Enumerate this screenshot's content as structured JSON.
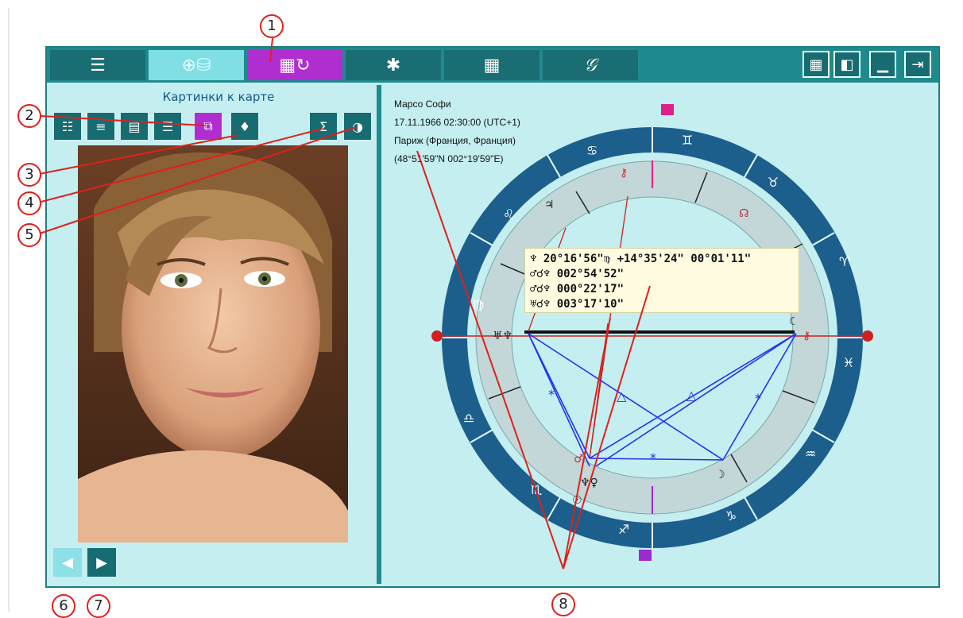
{
  "toolbar": {
    "tabs": [
      {
        "icon": "list-icon",
        "glyph": "☰"
      },
      {
        "icon": "globe-database-icon",
        "glyph": "⊕⛁"
      },
      {
        "icon": "photo-settings-icon",
        "glyph": "▦↻"
      },
      {
        "icon": "gear-icon",
        "glyph": "✱"
      },
      {
        "icon": "calculator-icon",
        "glyph": "▦"
      },
      {
        "icon": "script-icon",
        "glyph": "𝒢"
      }
    ],
    "right_buttons": [
      {
        "icon": "grid-icon",
        "glyph": "▦"
      },
      {
        "icon": "split-panel-icon",
        "glyph": "◧"
      },
      {
        "icon": "minimize-icon",
        "glyph": "▁"
      },
      {
        "icon": "exit-icon",
        "glyph": "⇥"
      }
    ]
  },
  "left_panel": {
    "title": "Картинки к карте",
    "buttons": [
      {
        "icon": "table-icon",
        "glyph": "☷"
      },
      {
        "icon": "numbered-list-icon",
        "glyph": "≡"
      },
      {
        "icon": "document-icon",
        "glyph": "▤"
      },
      {
        "icon": "text-list-icon",
        "glyph": "☰"
      },
      {
        "icon": "copy-icon",
        "glyph": "⧉"
      },
      {
        "icon": "location-pin-icon",
        "glyph": "♦"
      },
      {
        "icon": "sigma-document-icon",
        "glyph": "Σ"
      },
      {
        "icon": "yin-yang-icon",
        "glyph": "◑"
      }
    ],
    "nav": {
      "prev_glyph": "◀",
      "next_glyph": "▶"
    }
  },
  "chart_info": {
    "name": "Марсо Софи",
    "datetime": "17.11.1966 02:30:00 (UTC+1)",
    "place": "Париж (Франция, Франция)",
    "coords": "(48°51'59\"N 002°19'59\"E)"
  },
  "tooltip": {
    "line1": "♆ 20°16'56\"♍ +14°35'24\"  00°01'11\"",
    "line2": "♂☌♆ 002°54'52\"",
    "line3": "♂☌♆ 000°22'17\"",
    "line4": "♅☌♆ 003°17'10\""
  },
  "callouts": [
    "1",
    "2",
    "3",
    "4",
    "5",
    "6",
    "7",
    "8"
  ],
  "colors": {
    "teal_dark": "#1f8a8e",
    "teal_light": "#c4eef0",
    "purple": "#b02ed0",
    "wheel_blue": "#1c5f8c",
    "house_ring": "#c3d7d8",
    "aspect_blue": "#2233ee",
    "callout_red": "#e0201a"
  }
}
